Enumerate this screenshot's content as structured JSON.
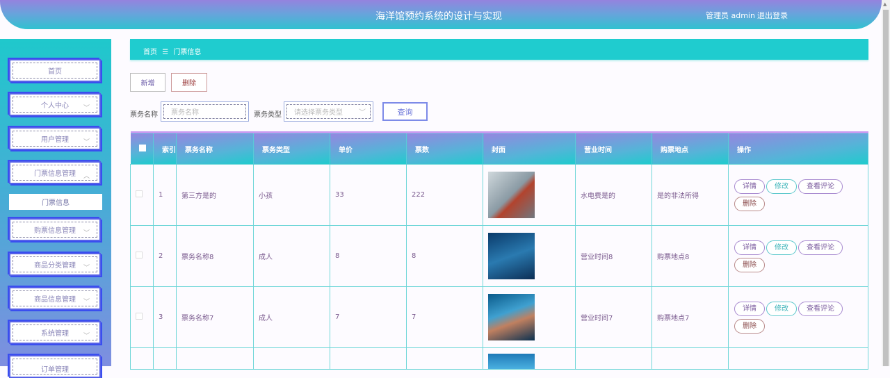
{
  "header": {
    "title": "海洋馆预约系统的设计与实现",
    "user": "管理员 admin",
    "logout": "退出登录"
  },
  "sidebar": {
    "items": [
      {
        "label": "首页"
      },
      {
        "label": "个人中心"
      },
      {
        "label": "用户管理"
      },
      {
        "label": "门票信息管理"
      },
      {
        "label": "购票信息管理"
      },
      {
        "label": "商品分类管理"
      },
      {
        "label": "商品信息管理"
      },
      {
        "label": "系统管理"
      },
      {
        "label": "订单管理"
      }
    ],
    "sub": "门票信息"
  },
  "breadcrumb": {
    "home": "首页",
    "sep": "☰",
    "current": "门票信息"
  },
  "toolbar": {
    "add": "新增",
    "delete": "删除",
    "name_label": "票务名称",
    "name_placeholder": "票务名称",
    "type_label": "票务类型",
    "type_placeholder": "请选择票务类型",
    "search": "查询"
  },
  "table": {
    "headers": [
      "索引",
      "票务名称",
      "票务类型",
      "单价",
      "票数",
      "封面",
      "营业时间",
      "购票地点",
      "操作"
    ],
    "rows": [
      {
        "index": "1",
        "name": "第三方是的",
        "type": "小孩",
        "price": "33",
        "count": "222",
        "time": "水电费是的",
        "location": "是的非法所得"
      },
      {
        "index": "2",
        "name": "票务名称8",
        "type": "成人",
        "price": "8",
        "count": "8",
        "time": "营业时间8",
        "location": "购票地点8"
      },
      {
        "index": "3",
        "name": "票务名称7",
        "type": "成人",
        "price": "7",
        "count": "7",
        "time": "营业时间7",
        "location": "购票地点7"
      }
    ],
    "actions": {
      "detail": "详情",
      "edit": "修改",
      "comments": "查看评论",
      "delete": "删除"
    }
  }
}
